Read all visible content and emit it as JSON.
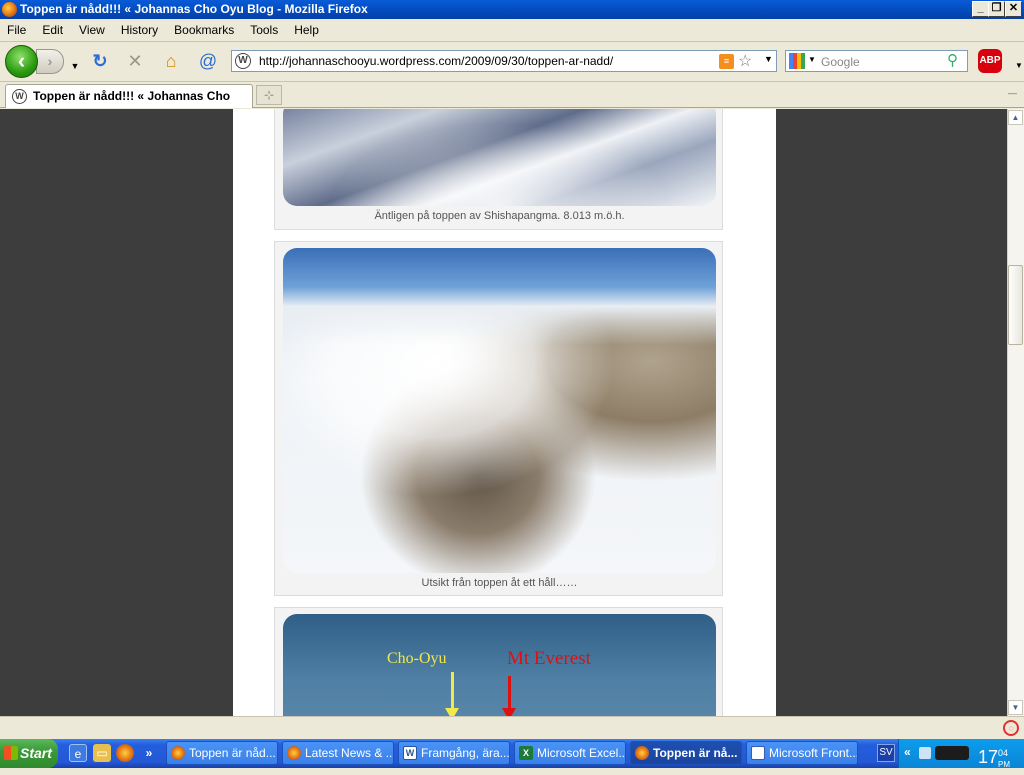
{
  "window": {
    "title": "Toppen är nådd!!! « Johannas Cho Oyu Blog - Mozilla Firefox",
    "minimize": "_",
    "maximize": "❐",
    "close": "✕"
  },
  "menu": [
    "File",
    "Edit",
    "View",
    "History",
    "Bookmarks",
    "Tools",
    "Help"
  ],
  "navigation": {
    "url": "http://johannaschooyu.wordpress.com/2009/09/30/toppen-ar-nadd/",
    "search_placeholder": "Google",
    "adblock_label": "ABP"
  },
  "tabs": [
    {
      "label": "Toppen är nådd!!! « Johannas Cho Oy...",
      "active": true
    }
  ],
  "page": {
    "photos": [
      {
        "caption": "Äntligen på toppen av Shishapangma. 8.013 m.ö.h."
      },
      {
        "caption": "Utsikt från toppen åt ett håll……"
      },
      {
        "caption": "",
        "labels": [
          "Cho-Oyu",
          "Mt Everest"
        ]
      }
    ]
  },
  "taskbar": {
    "start_label": "Start",
    "items": [
      {
        "label": "Toppen är nåd...",
        "icon": "firefox-icon"
      },
      {
        "label": "Latest News & ...",
        "icon": "firefox-icon"
      },
      {
        "label": "Framgång, ära...",
        "icon": "word-icon"
      },
      {
        "label": "Microsoft Excel...",
        "icon": "excel-icon"
      },
      {
        "label": "Toppen är nå...",
        "icon": "firefox-icon",
        "active": true
      },
      {
        "label": "Microsoft Front...",
        "icon": "frontpage-icon"
      }
    ],
    "language": "SV",
    "clock_hour": "17",
    "clock_minutes": "04",
    "clock_ampm": "PM"
  },
  "colors": {
    "accent": "#0450c4",
    "page_bg": "#3d3d3d",
    "cho_oyu_label": "#f2e84a",
    "everest_label": "#e01010"
  }
}
